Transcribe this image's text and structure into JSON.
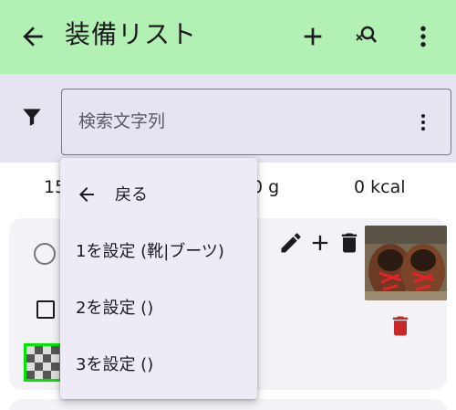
{
  "appbar": {
    "title": "装備リスト"
  },
  "search": {
    "placeholder": "検索文字列"
  },
  "summary": {
    "col1": "15",
    "col2": "0 g",
    "col3": "0 kcal"
  },
  "menu": {
    "back_label": "戻る",
    "items": [
      {
        "label": "1を設定 (靴|ブーツ)"
      },
      {
        "label": "2を設定 ()"
      },
      {
        "label": "3を設定 ()"
      }
    ]
  },
  "colors": {
    "appbar": "#b3f0b3",
    "filterbar": "#e7e4f1",
    "delete_red": "#c62828",
    "selected_border": "#00e600"
  },
  "icons": [
    "back-arrow-icon",
    "add-icon",
    "search-clear-icon",
    "more-vert-icon",
    "filter-icon",
    "edit-icon",
    "delete-icon"
  ]
}
